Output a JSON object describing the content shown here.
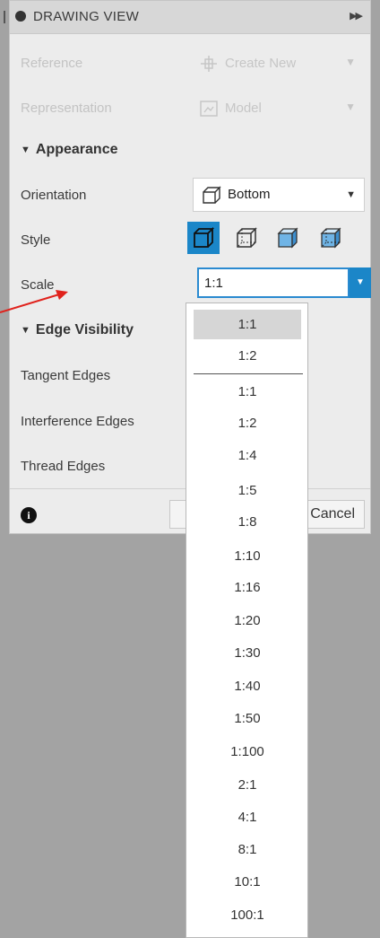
{
  "window": {
    "title": "DRAWING VIEW"
  },
  "reference": {
    "label": "Reference",
    "value": "Create New"
  },
  "representation": {
    "label": "Representation",
    "value": "Model"
  },
  "appearance": {
    "section_title": "Appearance",
    "orientation": {
      "label": "Orientation",
      "value": "Bottom",
      "icon": "cube-outline-icon"
    },
    "style": {
      "label": "Style",
      "options": [
        {
          "name": "visible-edges",
          "active": true
        },
        {
          "name": "visible-and-hidden-edges",
          "active": false
        },
        {
          "name": "shaded",
          "active": false
        },
        {
          "name": "shaded-with-hidden-edges",
          "active": false
        }
      ]
    },
    "scale": {
      "label": "Scale",
      "value": "1:1"
    }
  },
  "edge_visibility": {
    "section_title": "Edge Visibility",
    "rows": [
      {
        "label": "Tangent Edges"
      },
      {
        "label": "Interference Edges"
      },
      {
        "label": "Thread Edges"
      }
    ]
  },
  "footer": {
    "cancel_label": "Cancel"
  },
  "scale_dropdown": {
    "recent": [
      "1:1",
      "1:2"
    ],
    "options": [
      "1:1",
      "1:2",
      "1:4",
      "1:5",
      "1:8",
      "1:10",
      "1:16",
      "1:20",
      "1:30",
      "1:40",
      "1:50",
      "1:100",
      "2:1",
      "4:1",
      "8:1",
      "10:1",
      "100:1"
    ],
    "selected_recent_index": 0
  },
  "colors": {
    "accent": "#1b86c8",
    "annotation_arrow": "#e0221c",
    "panel_bg": "#ececec"
  }
}
